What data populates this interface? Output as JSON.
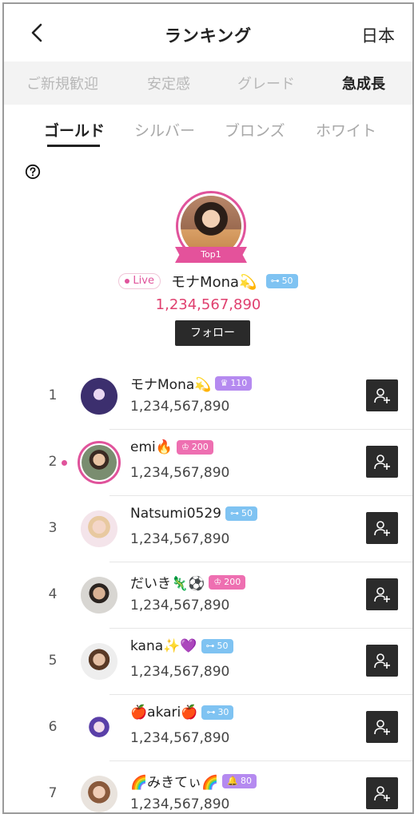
{
  "header": {
    "title": "ランキング",
    "region": "日本",
    "back_icon": "chevron-left-icon"
  },
  "category_tabs": [
    {
      "label": "ご新規歓迎",
      "active": false
    },
    {
      "label": "安定感",
      "active": false
    },
    {
      "label": "グレード",
      "active": false
    },
    {
      "label": "急成長",
      "active": true
    }
  ],
  "tier_tabs": [
    {
      "label": "ゴールド",
      "active": true
    },
    {
      "label": "シルバー",
      "active": false
    },
    {
      "label": "ブロンズ",
      "active": false
    },
    {
      "label": "ホワイト",
      "active": false
    }
  ],
  "help_icon": "question-circle-icon",
  "top": {
    "ribbon": "Top1",
    "live_label": "Live",
    "name": "モナMona💫",
    "badge": {
      "icon": "key-icon",
      "value": "50",
      "color": "#7fc3f2"
    },
    "score": "1,234,567,890",
    "follow_label": "フォロー",
    "accent": "#e0539b"
  },
  "rows": [
    {
      "rank": "1",
      "name": "モナMona💫",
      "badge": {
        "icon": "crown-icon",
        "value": "110",
        "color": "#b58af0"
      },
      "score": "1,234,567,890",
      "live": false
    },
    {
      "rank": "2",
      "name": "emi🔥",
      "badge": {
        "icon": "clock-icon",
        "value": "200",
        "color": "#ee6fb1"
      },
      "score": "1,234,567,890",
      "live": true
    },
    {
      "rank": "3",
      "name": "Natsumi0529",
      "badge": {
        "icon": "key-icon",
        "value": "50",
        "color": "#7fc3f2"
      },
      "score": "1,234,567,890",
      "live": false
    },
    {
      "rank": "4",
      "name": "だいき🦎⚽",
      "badge": {
        "icon": "clock-icon",
        "value": "200",
        "color": "#ee6fb1"
      },
      "score": "1,234,567,890",
      "live": false
    },
    {
      "rank": "5",
      "name": "kana✨💜",
      "badge": {
        "icon": "key-icon",
        "value": "50",
        "color": "#7fc3f2"
      },
      "score": "1,234,567,890",
      "live": false
    },
    {
      "rank": "6",
      "name": "🍎akari🍎",
      "badge": {
        "icon": "key-icon",
        "value": "30",
        "color": "#7fc3f2"
      },
      "score": "1,234,567,890",
      "live": false
    },
    {
      "rank": "7",
      "name": "🌈みきてぃ🌈",
      "badge": {
        "icon": "bell-icon",
        "value": "80",
        "color": "#b58af0"
      },
      "score": "1,234,567,890",
      "live": false
    }
  ],
  "add_icon": "add-user-icon"
}
